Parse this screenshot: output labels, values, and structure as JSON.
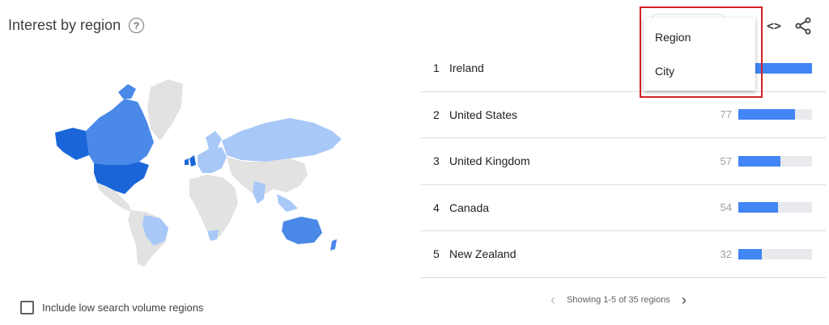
{
  "header": {
    "title": "Interest by region"
  },
  "toolbar": {
    "embed_glyph": "<>"
  },
  "dropdown": {
    "options": [
      "Region",
      "City"
    ]
  },
  "regions": [
    {
      "rank": "1",
      "name": "Ireland",
      "value": "100",
      "fill": 1.0
    },
    {
      "rank": "2",
      "name": "United States",
      "value": "77",
      "fill": 0.77
    },
    {
      "rank": "3",
      "name": "United Kingdom",
      "value": "57",
      "fill": 0.57
    },
    {
      "rank": "4",
      "name": "Canada",
      "value": "54",
      "fill": 0.54
    },
    {
      "rank": "5",
      "name": "New Zealand",
      "value": "32",
      "fill": 0.32
    }
  ],
  "pager": {
    "text": "Showing 1-5 of 35 regions"
  },
  "options": {
    "low_volume_label": "Include low search volume regions"
  },
  "colors": {
    "bar": "#4285f4",
    "highlight": "#d32027",
    "map_dark": "#1a66d9",
    "map_mid": "#4a89e8",
    "map_light": "#a8c8f8",
    "map_none": "#e2e2e2"
  }
}
